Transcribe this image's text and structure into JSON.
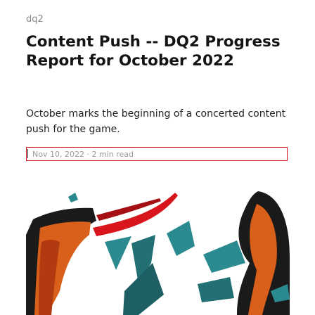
{
  "post": {
    "site_label": "dq2",
    "title": "Content Push -- DQ2 Progress Report for October 2022",
    "subtitle": "October marks the beginning of a concerted content push for the game.",
    "meta": "Nov 10, 2022 · 2 min read"
  },
  "hero_image": {
    "subject": "cover-artwork",
    "colors": {
      "accent": "#d8151c",
      "teal": "#2a8a90",
      "orange": "#d9601a",
      "dark": "#1a1a1a"
    }
  }
}
